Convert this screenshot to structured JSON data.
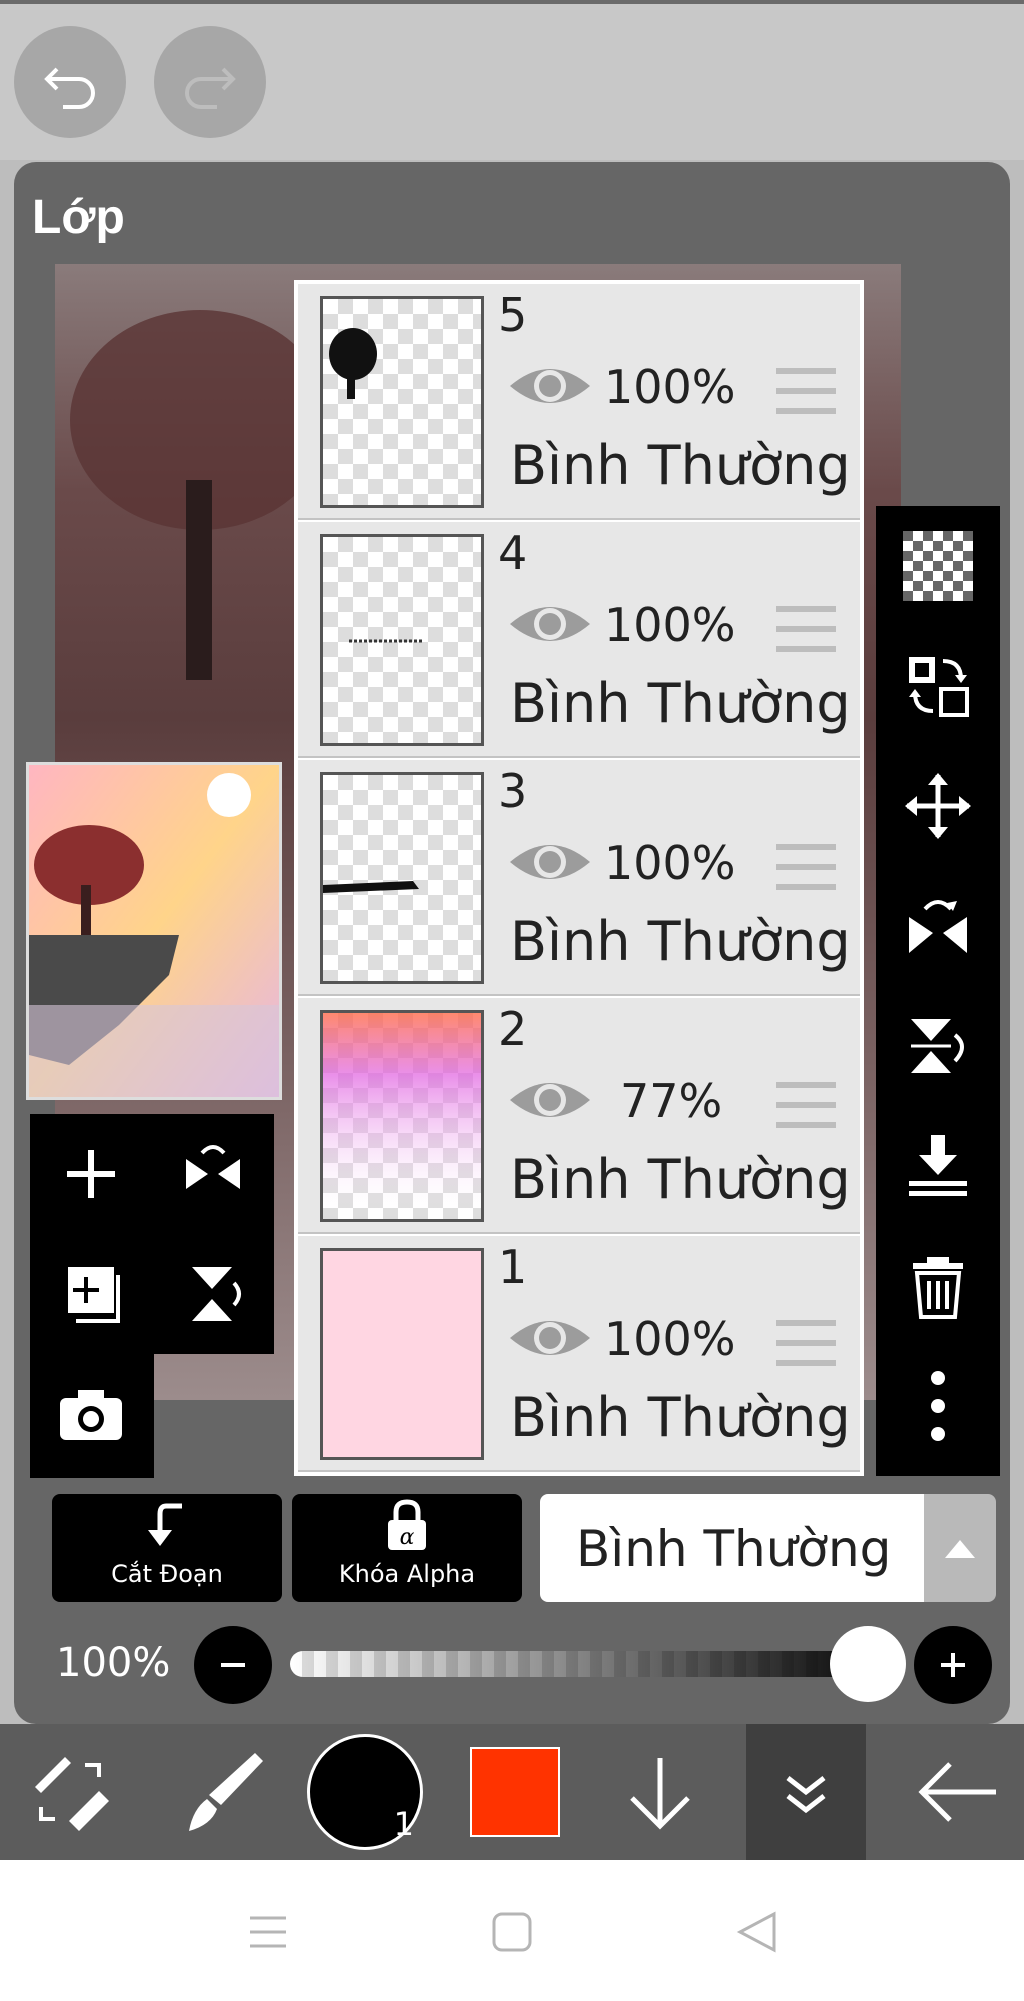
{
  "panel": {
    "title": "Lớp"
  },
  "layers": [
    {
      "num": "5",
      "opacity": "100%",
      "blend": "Bình Thường"
    },
    {
      "num": "4",
      "opacity": "100%",
      "blend": "Bình Thường"
    },
    {
      "num": "3",
      "opacity": "100%",
      "blend": "Bình Thường"
    },
    {
      "num": "2",
      "opacity": "77%",
      "blend": "Bình Thường"
    },
    {
      "num": "1",
      "opacity": "100%",
      "blend": "Bình Thường"
    }
  ],
  "buttons": {
    "clip_label": "Cắt Đoạn",
    "alpha_label": "Khóa Alpha"
  },
  "blend_mode": {
    "selected": "Bình Thường"
  },
  "opacity_control": {
    "label": "100%",
    "value": 1.0
  },
  "brush": {
    "size_label": "1"
  },
  "colors": {
    "primary": "#000000",
    "secondary": "#ff3300",
    "accent": "#666666"
  },
  "icons": [
    "undo-icon",
    "redo-icon",
    "add-layer-icon",
    "flip-horizontal-icon",
    "duplicate-layer-icon",
    "flip-vertical-icon",
    "camera-icon",
    "checkerboard-icon",
    "swap-icon",
    "move-icon",
    "flip-icon",
    "rotate-icon",
    "merge-down-icon",
    "trash-icon",
    "more-icon"
  ]
}
